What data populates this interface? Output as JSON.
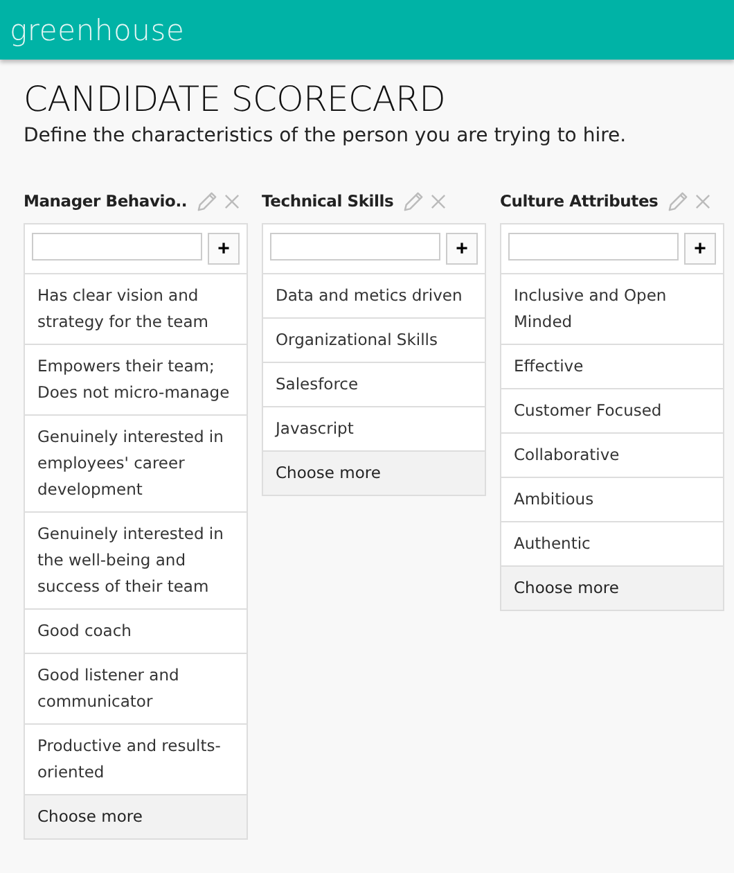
{
  "header": {
    "logo": "greenhouse"
  },
  "title": "CANDIDATE SCORECARD",
  "subtitle": "Define the characteristics of the person you are trying to hire.",
  "columns": [
    {
      "name": "Manager Behavio..",
      "items": [
        "Has clear vision and strategy for the team",
        "Empowers their team; Does not micro-manage",
        "Genuinely interested in employees' career development",
        "Genuinely interested in the well-being and success of their team",
        "Good coach",
        "Good listener and communicator",
        "Productive and results-oriented"
      ],
      "add_label": "+",
      "more": "Choose more"
    },
    {
      "name": "Technical Skills",
      "items": [
        "Data and metics driven",
        "Organizational Skills",
        "Salesforce",
        "Javascript"
      ],
      "add_label": "+",
      "more": "Choose more"
    },
    {
      "name": "Culture Attributes",
      "items": [
        "Inclusive and Open Minded",
        "Effective",
        "Customer Focused",
        "Collaborative",
        "Ambitious",
        "Authentic"
      ],
      "add_label": "+",
      "more": "Choose more"
    }
  ]
}
